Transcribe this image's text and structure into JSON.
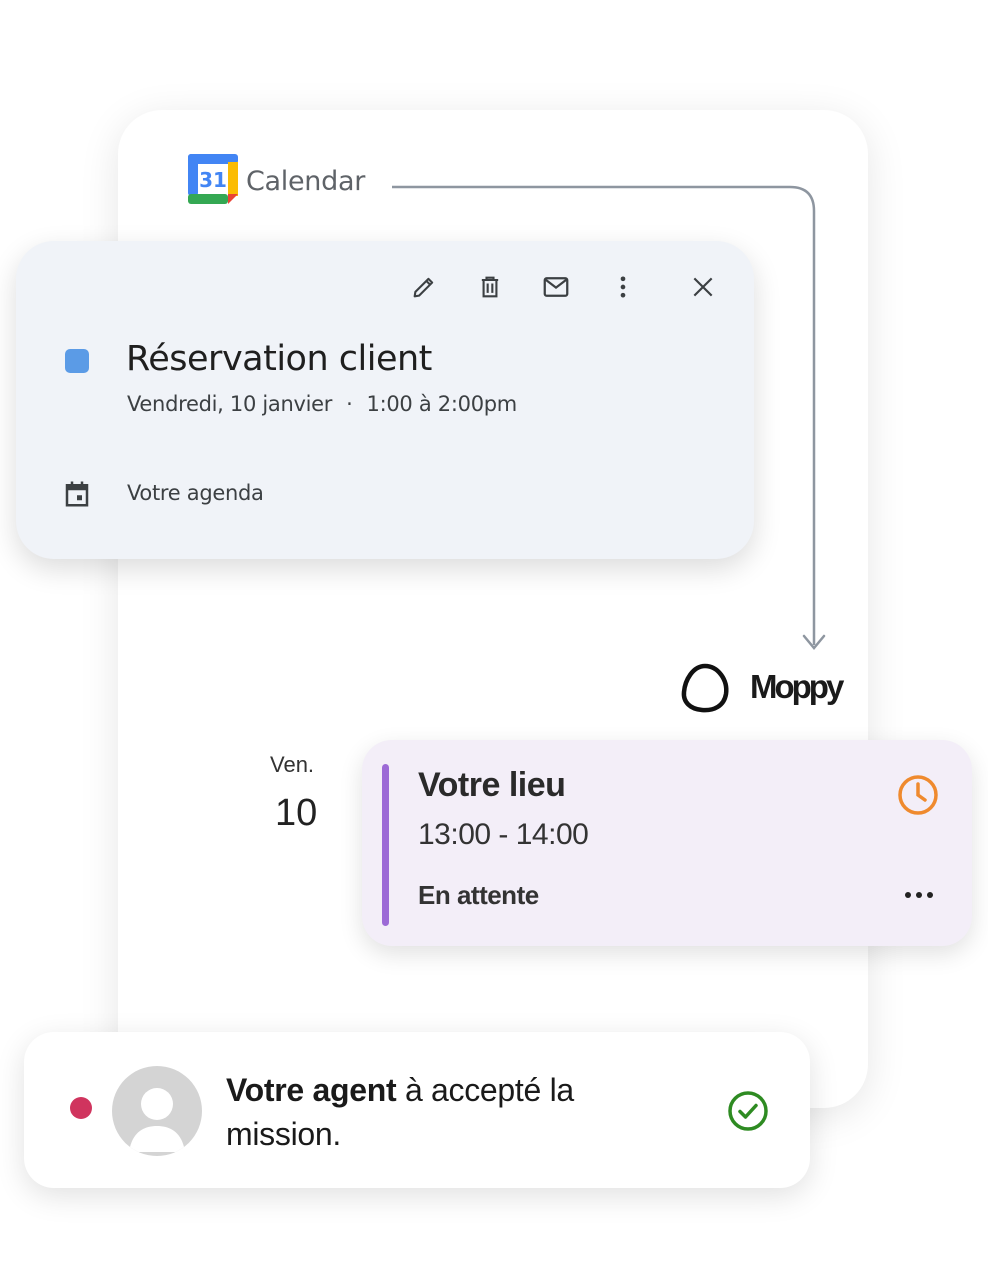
{
  "colors": {
    "gcal_blue": "#4285f4",
    "gcal_red": "#ea4335",
    "gcal_yellow": "#fbbc04",
    "gcal_green": "#34a853",
    "event_dot": "#5b9be6",
    "accent_purple": "#9c6ad6",
    "clock_orange": "#ef8a2e",
    "notif_dot": "#d0345e",
    "check_green": "#2e8b22",
    "connector_gray": "#8e96a0"
  },
  "gcal": {
    "logo_number": "31",
    "app_name": "Calendar"
  },
  "popup": {
    "toolbar": [
      {
        "icon": "edit-icon"
      },
      {
        "icon": "delete-icon"
      },
      {
        "icon": "email-icon"
      },
      {
        "icon": "more-vert-icon"
      },
      {
        "icon": "close-icon"
      }
    ],
    "title": "Réservation client",
    "date": "Vendredi, 10 janvier",
    "separator": "·",
    "time": "1:00 à 2:00pm",
    "calendar_name": "Votre agenda"
  },
  "moppy": {
    "brand": "Moppy"
  },
  "day": {
    "abbr": "Ven.",
    "number": "10"
  },
  "mission": {
    "place": "Votre lieu",
    "time_range": "13:00 - 14:00",
    "status": "En attente"
  },
  "notification": {
    "agent": "Votre agent",
    "message": " à accepté la mission."
  }
}
